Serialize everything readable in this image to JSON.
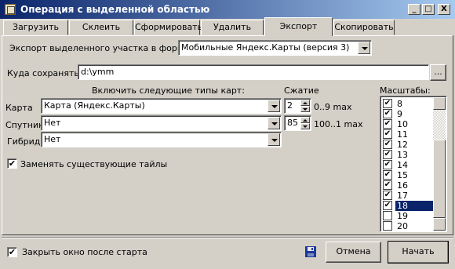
{
  "window": {
    "title": "Операция с выделенной областью",
    "buttons": {
      "minimize": "_",
      "maximize": "□",
      "close": "X"
    }
  },
  "tabs": [
    {
      "label": "Загрузить",
      "active": false
    },
    {
      "label": "Склеить",
      "active": false
    },
    {
      "label": "Сформировать",
      "active": false
    },
    {
      "label": "Удалить",
      "active": false
    },
    {
      "label": "Экспорт",
      "active": true
    },
    {
      "label": "Скопировать",
      "active": false
    }
  ],
  "export": {
    "format_label": "Экспорт выделенного участка в формат",
    "format_value": "Мобильные Яндекс.Карты (версия 3)",
    "path_label": "Куда сохранять:",
    "path_value": "d:\\ymm",
    "browse_label": "...",
    "include_header": "Включить следующие типы карт:",
    "compression_header": "Сжатие",
    "scales_header": "Масштабы:",
    "rows": [
      {
        "label": "Карта",
        "map": "Карта (Яндекс.Карты)",
        "compression": "2",
        "range": "0..9 max"
      },
      {
        "label": "Спутник",
        "map": "Нет",
        "compression": "85",
        "range": "100..1 max"
      },
      {
        "label": "Гибрид",
        "map": "Нет"
      }
    ],
    "replace_tiles_label": "Заменять существующие тайлы",
    "replace_tiles_checked": true,
    "scales": [
      {
        "value": "8",
        "checked": true,
        "selected": false
      },
      {
        "value": "9",
        "checked": true,
        "selected": false
      },
      {
        "value": "10",
        "checked": true,
        "selected": false
      },
      {
        "value": "11",
        "checked": true,
        "selected": false
      },
      {
        "value": "12",
        "checked": true,
        "selected": false
      },
      {
        "value": "13",
        "checked": true,
        "selected": false
      },
      {
        "value": "14",
        "checked": true,
        "selected": false
      },
      {
        "value": "15",
        "checked": true,
        "selected": false
      },
      {
        "value": "16",
        "checked": true,
        "selected": false
      },
      {
        "value": "17",
        "checked": true,
        "selected": false
      },
      {
        "value": "18",
        "checked": true,
        "selected": true
      },
      {
        "value": "19",
        "checked": false,
        "selected": false
      },
      {
        "value": "20",
        "checked": false,
        "selected": false
      }
    ]
  },
  "footer": {
    "close_after_start_label": "Закрыть окно после старта",
    "close_after_start_checked": true,
    "cancel_label": "Отмена",
    "start_label": "Начать"
  },
  "colors": {
    "titlebar_start": "#0a246a",
    "titlebar_end": "#a6caf0",
    "selection": "#0a246a",
    "face": "#d4d0c8",
    "save_icon": "#1a3a9a"
  },
  "icons": {
    "save": "floppy-disk-icon",
    "check": "✔"
  }
}
